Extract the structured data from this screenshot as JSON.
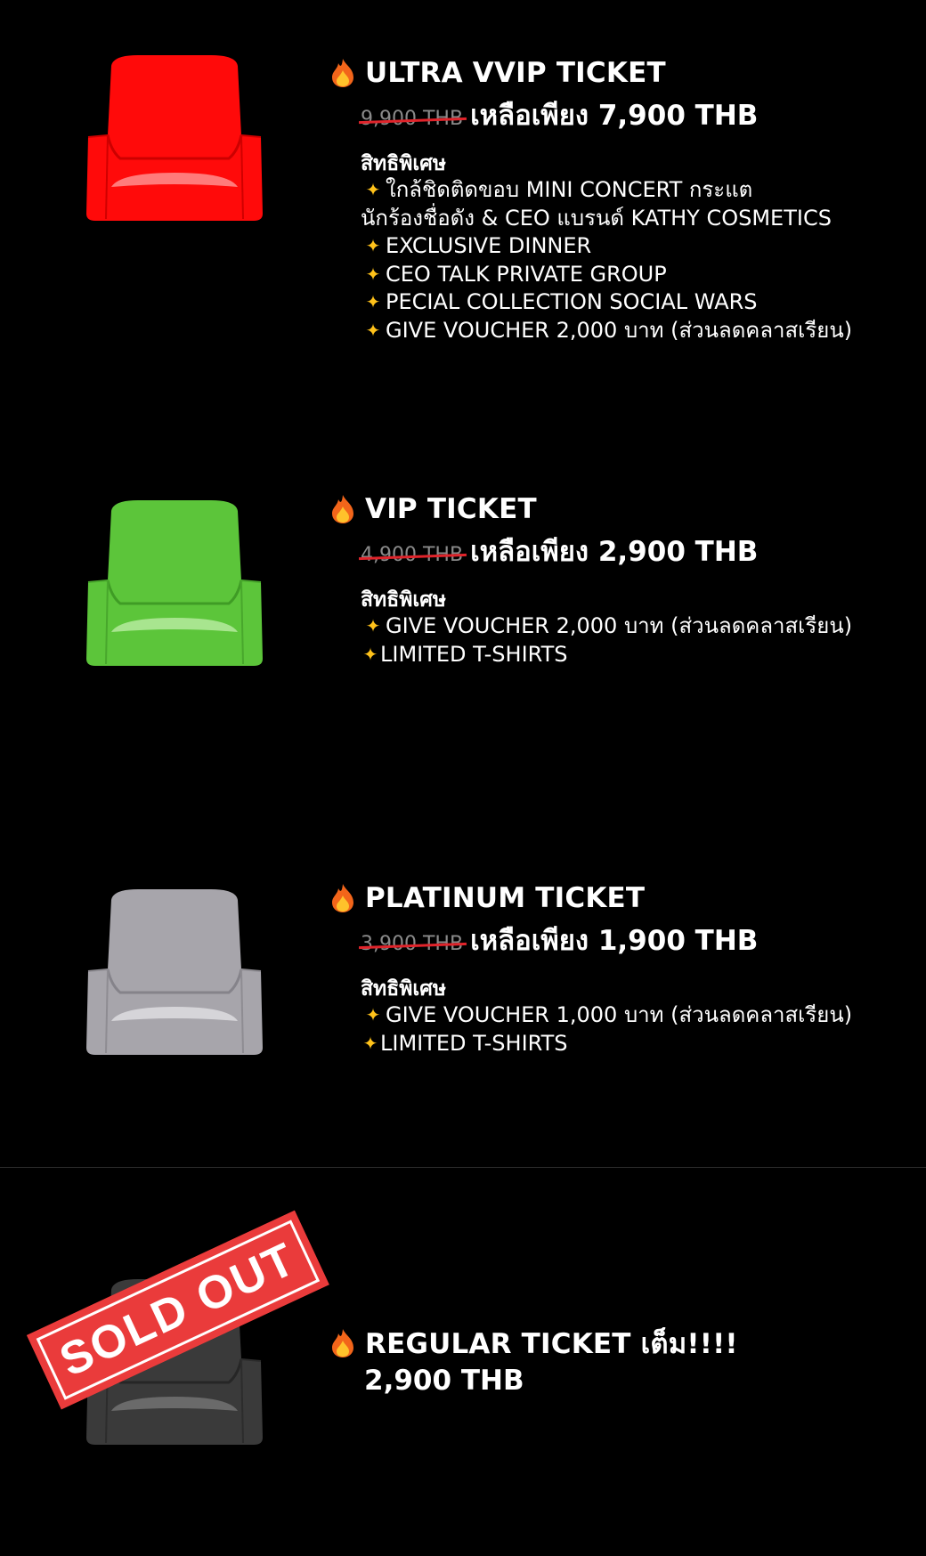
{
  "tickets": [
    {
      "title": "ULTRA VVIP TICKET",
      "old_price": "9,900 THB",
      "new_price": "เหลือเพียง 7,900 THB",
      "perks_heading": "สิทธิพิเศษ",
      "seat_color": "#ff0a0a",
      "perks": [
        "ใกล้ชิดติดขอบ MINI CONCERT กระแต",
        "นักร้องชื่อดัง & CEO แบรนด์ KATHY COSMETICS",
        "EXCLUSIVE DINNER",
        "CEO TALK PRIVATE GROUP",
        "PECIAL COLLECTION SOCIAL WARS",
        "GIVE VOUCHER 2,000 บาท (ส่วนลดคลาสเรียน)"
      ]
    },
    {
      "title": "VIP TICKET",
      "old_price": "4,900 THB",
      "new_price": "เหลือเพียง 2,900 THB",
      "perks_heading": "สิทธิพิเศษ",
      "seat_color": "#5cc53a",
      "perks": [
        "GIVE VOUCHER 2,000 บาท (ส่วนลดคลาสเรียน)",
        "LIMITED T-SHIRTS"
      ]
    },
    {
      "title": "PLATINUM TICKET",
      "old_price": "3,900 THB",
      "new_price": "เหลือเพียง 1,900 THB",
      "perks_heading": "สิทธิพิเศษ",
      "seat_color": "#a7a5ab",
      "perks": [
        "GIVE VOUCHER 1,000 บาท (ส่วนลดคลาสเรียน)",
        "LIMITED T-SHIRTS"
      ]
    },
    {
      "title": "REGULAR TICKET เต็ม!!!!",
      "price": "2,900 THB",
      "seat_color": "#3a3a3a",
      "stamp": "SOLD OUT",
      "stamp_color": "#ea3b3b"
    }
  ],
  "icons": {
    "title_icon": "fire-icon",
    "perk_icon": "sparkle-icon"
  }
}
